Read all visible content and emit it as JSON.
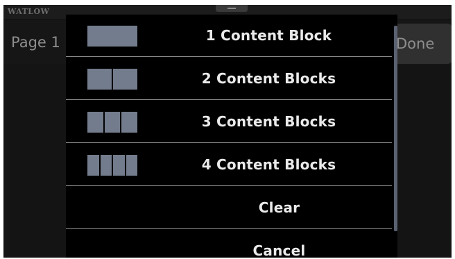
{
  "device": {
    "brand": "WATLOW"
  },
  "header": {
    "page_label": "Page 1",
    "done_label": "Done"
  },
  "menu": {
    "items": [
      {
        "label": "1 Content Block",
        "icon": "one-block-icon",
        "blocks": 1
      },
      {
        "label": "2 Content Blocks",
        "icon": "two-blocks-icon",
        "blocks": 2
      },
      {
        "label": "3 Content Blocks",
        "icon": "three-blocks-icon",
        "blocks": 3
      },
      {
        "label": "4 Content Blocks",
        "icon": "four-blocks-icon",
        "blocks": 4
      },
      {
        "label": "Clear"
      },
      {
        "label": "Cancel"
      }
    ]
  },
  "colors": {
    "icon_block": "#737c8c",
    "menu_background": "#000000",
    "divider": "#8c8c8c",
    "text": "#eaeaea"
  }
}
